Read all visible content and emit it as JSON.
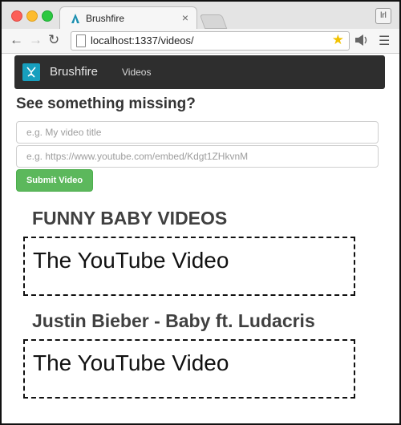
{
  "browser": {
    "tab_title": "Brushfire",
    "tab_close": "×",
    "profile_label": "lrl",
    "url": "localhost:1337/videos/"
  },
  "navbar": {
    "brand": "Brushfire",
    "link": "Videos"
  },
  "form": {
    "heading": "See something missing?",
    "title_placeholder": "e.g. My video title",
    "src_placeholder": "e.g. https://www.youtube.com/embed/Kdgt1ZHkvnM",
    "submit_label": "Submit Video"
  },
  "videos": [
    {
      "title": "FUNNY BABY VIDEOS",
      "content": "The YouTube Video"
    },
    {
      "title": "Justin Bieber - Baby ft. Ludacris",
      "content": "The YouTube Video"
    }
  ],
  "colors": {
    "brand_accent": "#179fbe",
    "submit_button": "#5cb85c",
    "navbar_bg": "#2e2e2e"
  }
}
